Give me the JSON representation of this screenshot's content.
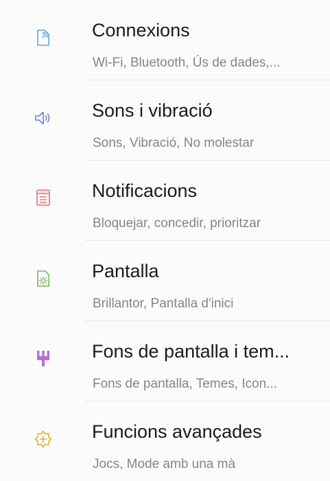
{
  "settings_list": {
    "items": [
      {
        "id": "connections",
        "icon": "connections-icon",
        "icon_color": "#5aa9dd",
        "title": "Connexions",
        "subtitle": "Wi-Fi, Bluetooth, Ús de dades,..."
      },
      {
        "id": "sounds",
        "icon": "speaker-icon",
        "icon_color": "#6f7fc7",
        "title": "Sons i vibració",
        "subtitle": "Sons, Vibració, No molestar"
      },
      {
        "id": "notifications",
        "icon": "notifications-icon",
        "icon_color": "#e16f6f",
        "title": "Notificacions",
        "subtitle": "Bloquejar, concedir, prioritzar"
      },
      {
        "id": "display",
        "icon": "display-brightness-icon",
        "icon_color": "#7ab84c",
        "title": "Pantalla",
        "subtitle": "Brillantor, Pantalla d'inici"
      },
      {
        "id": "wallpapers",
        "icon": "paintbrush-icon",
        "icon_color": "#b56fd1",
        "title": "Fons de pantalla i tem...",
        "subtitle": "Fons de pantalla, Temes, Icon..."
      },
      {
        "id": "advanced",
        "icon": "advanced-features-icon",
        "icon_color": "#e8ac28",
        "title": "Funcions avançades",
        "subtitle": "Jocs, Mode amb una mà"
      }
    ]
  }
}
